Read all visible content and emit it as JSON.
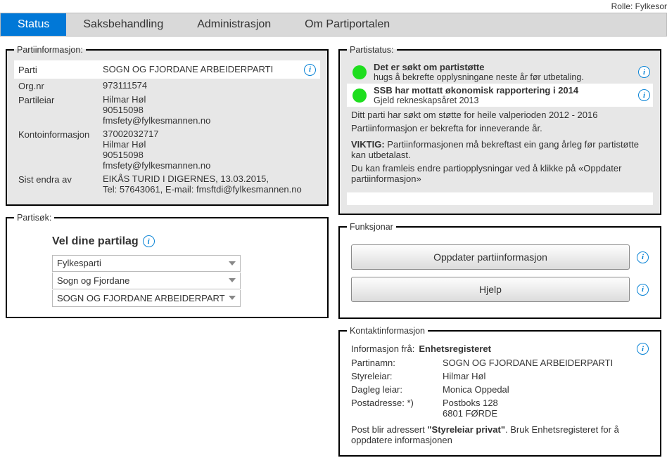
{
  "role_label": "Rolle: Fylkesor",
  "tabs": {
    "status": "Status",
    "saks": "Saksbehandling",
    "admin": "Administrasjon",
    "om": "Om Partiportalen"
  },
  "partiinfo": {
    "legend": "Partiinformasjon:",
    "parti_label": "Parti",
    "parti_value": "SOGN OG FJORDANE ARBEIDERPARTI",
    "orgnr_label": "Org.nr",
    "orgnr_value": "973111574",
    "partileiar_label": "Partileiar",
    "partileiar_name": "Hilmar Høl",
    "partileiar_phone": "90515098",
    "partileiar_email": "fmsfety@fylkesmannen.no",
    "konto_label": "Kontoinformasjon",
    "konto_nr": "37002032717",
    "konto_name": "Hilmar Høl",
    "konto_phone": "90515098",
    "konto_email": "fmsfety@fylkesmannen.no",
    "sist_label": "Sist endra av",
    "sist_value1": "EIKÅS TURID I DIGERNES, 13.03.2015,",
    "sist_value2": "Tel: 57643061, E-mail: fmsftdi@fylkesmannen.no"
  },
  "partistatus": {
    "legend": "Partistatus:",
    "item1_title": "Det er søkt om partistøtte",
    "item1_sub": "hugs å bekrefte opplysningane neste år før utbetaling.",
    "item2_title": "SSB har mottatt økonomisk rapportering i 2014",
    "item2_sub": "Gjeld rekneskapsåret 2013",
    "note1": "Ditt parti har søkt om støtte for heile valperioden 2012 - 2016",
    "note2": "Partiinformasjon er bekrefta for inneverande år.",
    "note3a": "VIKTIG:",
    "note3b": " Partiinformasjonen må bekreftast ein gang årleg før partistøtte kan utbetalast.",
    "note4": "Du kan framleis endre partiopplysningar ved å klikke på «Oppdater partiinformasjon»"
  },
  "partisok": {
    "legend": "Partisøk:",
    "heading": "Vel dine partilag",
    "sel1": "Fylkesparti",
    "sel2": "Sogn og Fjordane",
    "sel3": "SOGN OG FJORDANE ARBEIDERPART"
  },
  "funksjonar": {
    "legend": "Funksjonar",
    "btn1": "Oppdater partiinformasjon",
    "btn2": "Hjelp"
  },
  "kontakt": {
    "legend": "Kontaktinformasjon",
    "info_from": "Informasjon frå:",
    "info_source": "Enhetsregisteret",
    "partinamn_label": "Partinamn:",
    "partinamn_value": "SOGN OG FJORDANE ARBEIDERPARTI",
    "styreleiar_label": "Styreleiar:",
    "styreleiar_value": "Hilmar Høl",
    "dagleg_label": "Dagleg leiar:",
    "dagleg_value": "Monica Oppedal",
    "post_label": "Postadresse: *)",
    "post_value1": "Postboks 128",
    "post_value2": "6801 FØRDE",
    "note1a": "Post blir adressert ",
    "note1b": "\"Styreleiar privat\"",
    "note1c": ". Bruk Enhetsregisteret for å oppdatere informasjonen"
  }
}
